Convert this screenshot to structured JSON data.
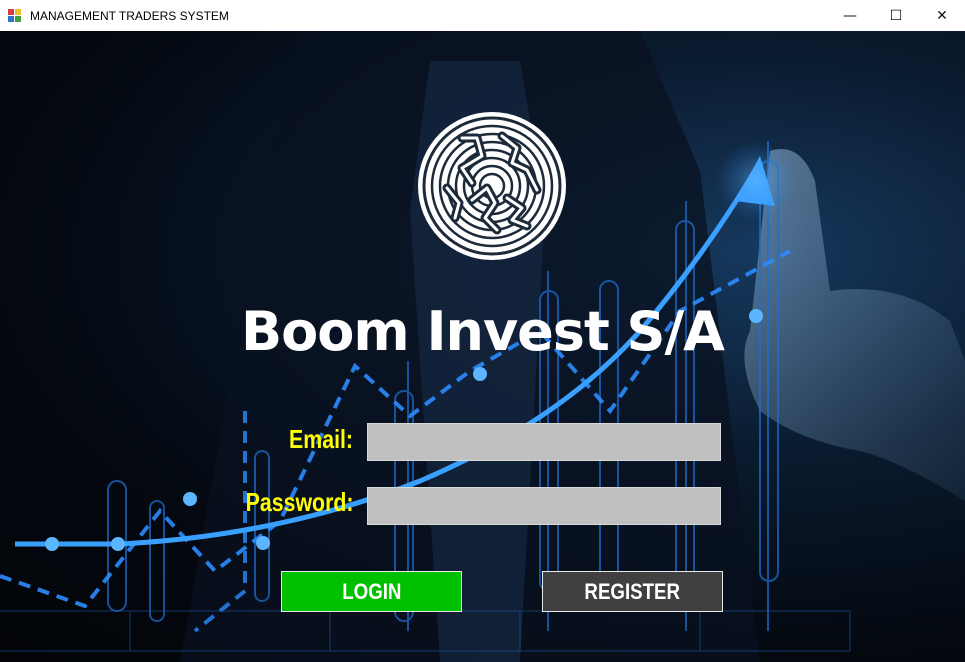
{
  "window": {
    "title": "MANAGEMENT TRADERS SYSTEM",
    "minimize_glyph": "—",
    "maximize_glyph": "☐",
    "close_glyph": "✕"
  },
  "brand": {
    "name": "Boom Invest S/A",
    "logo_icon": "fingerprint-maze-logo"
  },
  "form": {
    "email_label": "Email:",
    "email_value": "",
    "password_label": "Password:",
    "password_value": ""
  },
  "buttons": {
    "login_label": "LOGIN",
    "register_label": "REGISTER"
  },
  "colors": {
    "label_yellow": "#ffff00",
    "login_green": "#00c000",
    "register_gray": "#404040",
    "field_gray": "#c0c0c0",
    "chart_blue": "#2b8cff"
  }
}
